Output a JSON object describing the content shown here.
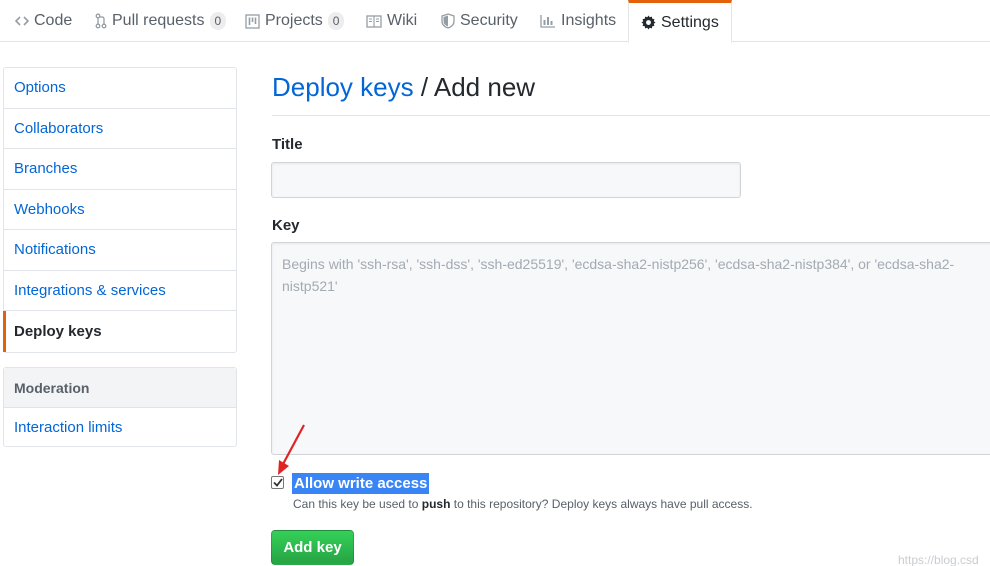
{
  "reponav": {
    "code": "Code",
    "pulls": "Pull requests",
    "pulls_count": "0",
    "projects": "Projects",
    "projects_count": "0",
    "wiki": "Wiki",
    "security": "Security",
    "insights": "Insights",
    "settings": "Settings",
    "accent_color": "#e36209"
  },
  "sidebar": {
    "items": [
      {
        "label": "Options"
      },
      {
        "label": "Collaborators"
      },
      {
        "label": "Branches"
      },
      {
        "label": "Webhooks"
      },
      {
        "label": "Notifications"
      },
      {
        "label": "Integrations & services"
      },
      {
        "label": "Deploy keys",
        "selected": true
      }
    ],
    "moderation_heading": "Moderation",
    "moderation_items": [
      {
        "label": "Interaction limits"
      }
    ]
  },
  "main": {
    "title_link": "Deploy keys",
    "title_sep": " / ",
    "title_rest": "Add new",
    "title_label": "Title",
    "title_value": "",
    "key_label": "Key",
    "key_placeholder": "Begins with 'ssh-rsa', 'ssh-dss', 'ssh-ed25519', 'ecdsa-sha2-nistp256', 'ecdsa-sha2-nistp384', or 'ecdsa-sha2-nistp521'",
    "write_access_label": "Allow write access",
    "write_access_checked": true,
    "note_before": "Can this key be used to ",
    "note_bold": "push",
    "note_after": " to this repository? Deploy keys always have pull access.",
    "submit_label": "Add key",
    "submit_color": "#28a745"
  },
  "watermark": "https://blog.csd"
}
